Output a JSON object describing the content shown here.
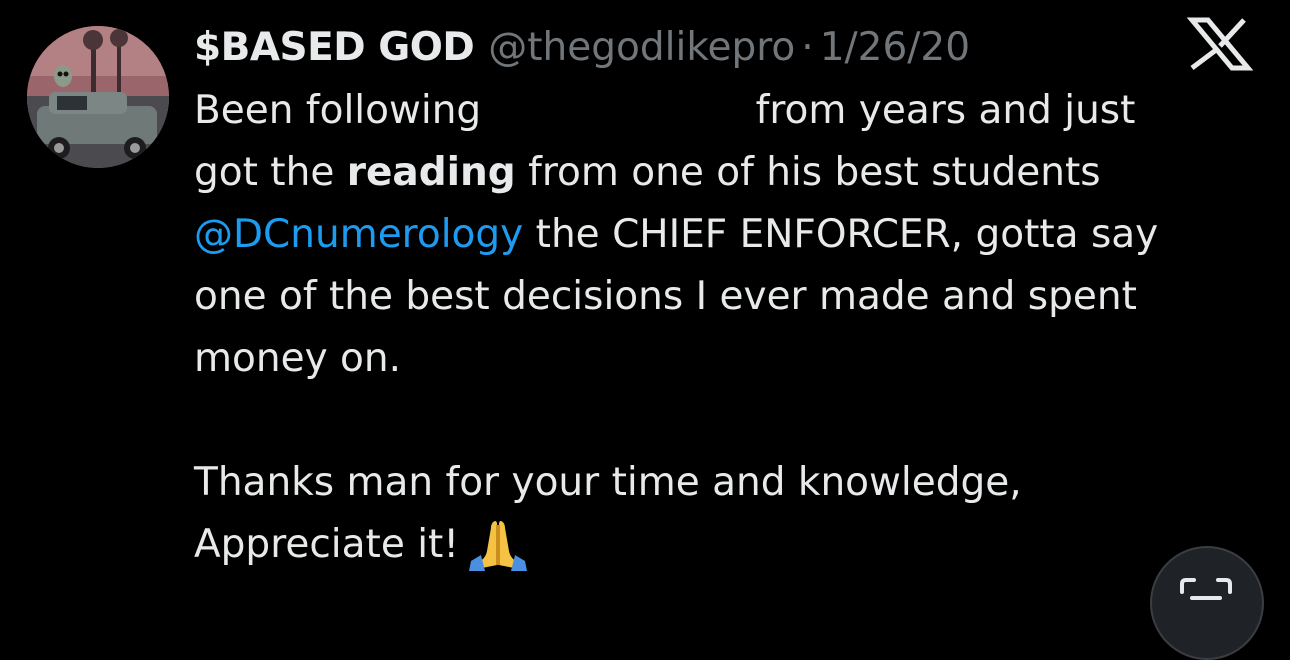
{
  "tweet": {
    "display_name": "$BASED GOD",
    "handle": "@thegodlikepro",
    "separator": "·",
    "date": "1/26/20",
    "lines": {
      "l1_a": "Been following",
      "l1_b": "from years and just",
      "l2_a": "got the ",
      "l2_bold": "reading",
      "l2_b": " from one of his best students",
      "l3_mention": "@DCnumerology",
      "l3_b": " the CHIEF ENFORCER, gotta say",
      "l4": "one of the best decisions I ever made and spent",
      "l5": "money on.",
      "l6": "Thanks man for your time and knowledge,",
      "l7": "Appreciate it!"
    }
  },
  "icons": {
    "brand": "x-logo-icon",
    "emoji": "folded-hands-emoji",
    "corner": "scan-text-icon"
  },
  "colors": {
    "background": "#000000",
    "text": "#e7e9ea",
    "muted": "#71767b",
    "mention": "#1d9bf0"
  }
}
